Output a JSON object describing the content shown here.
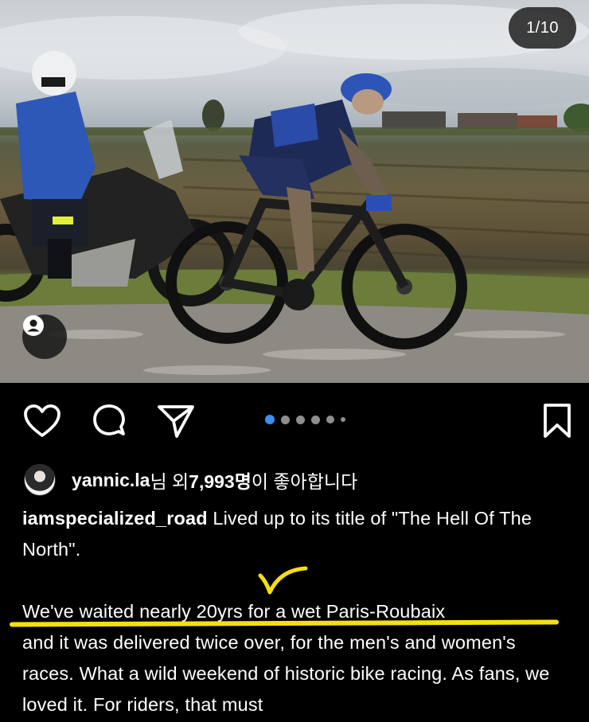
{
  "photo": {
    "page_counter": "1/10",
    "alt_icon": "person-tag-icon"
  },
  "actions": {
    "like_icon": "heart-icon",
    "comment_icon": "comment-icon",
    "share_icon": "send-icon",
    "save_icon": "bookmark-icon",
    "carousel": {
      "total_dots": 6,
      "active_index": 0
    }
  },
  "likes": {
    "username": "yannic.la",
    "mid_text": "님 외 ",
    "count": "7,993명",
    "tail_text": "이 좋아합니다"
  },
  "caption": {
    "username": "iamspecialized_road",
    "line1_rest": " Lived up to its title of \"The Hell Of The North\".",
    "highlight": "We've waited nearly 20yrs for a wet Paris-Roubaix",
    "rest": "and it was delivered twice over, for the men's and women's races. What a wild weekend of historic bike racing. As fans, we loved it. For riders, that must"
  },
  "annotation": {
    "underline_color": "#f5df12",
    "check_color": "#f5df12"
  },
  "colors": {
    "background": "#000000",
    "text": "#ffffff",
    "active_dot": "#3d8ef0",
    "inactive_dot": "#8e8e8e"
  }
}
